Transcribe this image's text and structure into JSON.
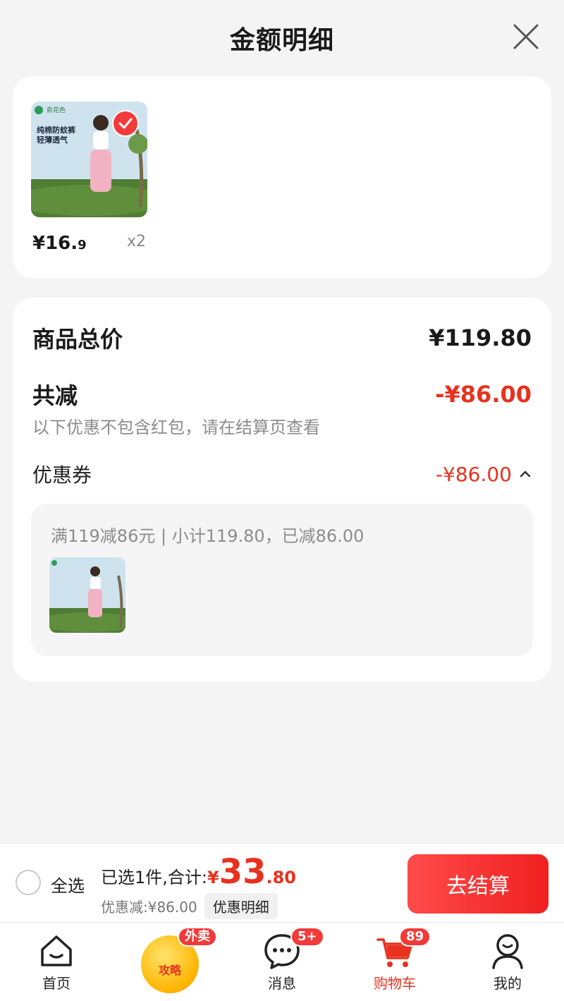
{
  "header": {
    "title": "金额明细"
  },
  "product": {
    "thumb_brand": "俞花色",
    "thumb_line1": "纯棉防蚊裤",
    "thumb_line2": "轻薄透气",
    "price_main": "¥16.",
    "price_dec": "9",
    "qty": "x2"
  },
  "detail": {
    "total_label": "商品总价",
    "total_value": "¥119.80",
    "reduce_label": "共减",
    "reduce_value": "-¥86.00",
    "reduce_note": "以下优惠不包含红包，请在结算页查看",
    "coupon_label": "优惠券",
    "coupon_value": "-¥86.00",
    "coupon_rule": "满119减86元 | 小计119.80，已减86.00"
  },
  "bottom": {
    "select_all": "全选",
    "selected_label": "已选1件,合计:",
    "yen": "¥",
    "total_int": "33",
    "total_dec": ".80",
    "discount_text": "优惠减:¥86.00",
    "detail_chip": "优惠明细",
    "checkout": "去结算"
  },
  "tabs": {
    "home": "首页",
    "promo_text": "攻略",
    "promo_badge": "外卖",
    "messages": "消息",
    "messages_badge": "5+",
    "cart": "购物车",
    "cart_badge": "89",
    "mine": "我的"
  },
  "colors": {
    "accent": "#e8321f",
    "badge": "#f23a3a"
  }
}
